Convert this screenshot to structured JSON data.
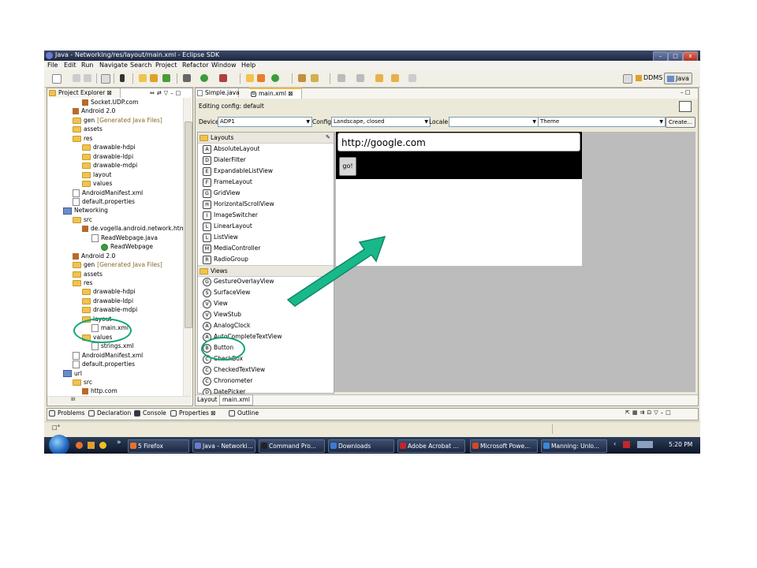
{
  "window": {
    "title": "Java - Networking/res/layout/main.xml - Eclipse SDK",
    "btn_min": "–",
    "btn_max": "□",
    "btn_close": "x"
  },
  "menu": [
    "File",
    "Edit",
    "Run",
    "Navigate",
    "Search",
    "Project",
    "Refactor",
    "Window",
    "Help"
  ],
  "perspectives": {
    "ddms": "DDMS",
    "java": "Java"
  },
  "project_explorer": {
    "title": "Project Explorer",
    "items": [
      {
        "label": "Socket.UDP.com",
        "icon": "package",
        "indent": 3
      },
      {
        "label": "Android 2.0",
        "icon": "library",
        "indent": 2
      },
      {
        "label": "gen",
        "suffix": "[Generated Java Files]",
        "icon": "folder",
        "indent": 2
      },
      {
        "label": "assets",
        "icon": "folder",
        "indent": 2
      },
      {
        "label": "res",
        "icon": "folder",
        "indent": 2
      },
      {
        "label": "drawable-hdpi",
        "icon": "folder",
        "indent": 3
      },
      {
        "label": "drawable-ldpi",
        "icon": "folder",
        "indent": 3
      },
      {
        "label": "drawable-mdpi",
        "icon": "folder",
        "indent": 3
      },
      {
        "label": "layout",
        "icon": "folder",
        "indent": 3
      },
      {
        "label": "values",
        "icon": "folder",
        "indent": 3
      },
      {
        "label": "AndroidManifest.xml",
        "icon": "file",
        "indent": 2
      },
      {
        "label": "default.properties",
        "icon": "file",
        "indent": 2
      },
      {
        "label": "Networking",
        "icon": "project",
        "indent": 1
      },
      {
        "label": "src",
        "icon": "folder",
        "indent": 2
      },
      {
        "label": "de.vogella.android.network.html",
        "icon": "package",
        "indent": 3
      },
      {
        "label": "ReadWebpage.java",
        "icon": "file",
        "indent": 4
      },
      {
        "label": "ReadWebpage",
        "icon": "class",
        "indent": 5
      },
      {
        "label": "Android 2.0",
        "icon": "library",
        "indent": 2
      },
      {
        "label": "gen",
        "suffix": "[Generated Java Files]",
        "icon": "folder",
        "indent": 2
      },
      {
        "label": "assets",
        "icon": "folder",
        "indent": 2
      },
      {
        "label": "res",
        "icon": "folder",
        "indent": 2
      },
      {
        "label": "drawable-hdpi",
        "icon": "folder",
        "indent": 3
      },
      {
        "label": "drawable-ldpi",
        "icon": "folder",
        "indent": 3
      },
      {
        "label": "drawable-mdpi",
        "icon": "folder",
        "indent": 3
      },
      {
        "label": "layout",
        "icon": "folder",
        "indent": 3
      },
      {
        "label": "main.xml",
        "icon": "file",
        "indent": 4
      },
      {
        "label": "values",
        "icon": "folder",
        "indent": 3
      },
      {
        "label": "strings.xml",
        "icon": "file",
        "indent": 4
      },
      {
        "label": "AndroidManifest.xml",
        "icon": "file",
        "indent": 2
      },
      {
        "label": "default.properties",
        "icon": "file",
        "indent": 2
      },
      {
        "label": "url",
        "icon": "project",
        "indent": 1
      },
      {
        "label": "src",
        "icon": "folder",
        "indent": 2
      },
      {
        "label": "http.com",
        "icon": "package",
        "indent": 3
      }
    ],
    "hscroll_label": "III"
  },
  "editor": {
    "tabs": [
      {
        "label": "Simple.java"
      },
      {
        "label": "main.xml"
      }
    ],
    "editing_config": "Editing config: default",
    "devices_label": "Devices",
    "device_value": "ADP1",
    "config_label": "Config",
    "config_value": "Landscape, closed",
    "locale_label": "Locale",
    "locale_value": "",
    "theme_value": "Theme",
    "create_button": "Create...",
    "bottom_tabs": [
      "Layout",
      "main.xml"
    ]
  },
  "palette": {
    "layouts_header": "Layouts",
    "layouts": [
      "AbsoluteLayout",
      "DialerFilter",
      "ExpandableListView",
      "FrameLayout",
      "GridView",
      "HorizontalScrollView",
      "ImageSwitcher",
      "LinearLayout",
      "ListView",
      "MediaController",
      "RadioGroup"
    ],
    "layout_icons": [
      "A",
      "D",
      "E",
      "F",
      "G",
      "H",
      "I",
      "L",
      "L",
      "M",
      "R"
    ],
    "views_header": "Views",
    "views": [
      "GestureOverlayView",
      "SurfaceView",
      "View",
      "ViewStub",
      "AnalogClock",
      "AutoCompleteTextView",
      "Button",
      "CheckBox",
      "CheckedTextView",
      "Chronometer",
      "DatePicker"
    ],
    "view_icons": [
      "G",
      "S",
      "V",
      "V",
      "A",
      "A",
      "B",
      "C",
      "C",
      "C",
      "D"
    ]
  },
  "preview": {
    "url_text": "http://google.com",
    "go_button": "go!"
  },
  "bottom_panel": {
    "tabs": [
      "Problems",
      "Declaration",
      "Console",
      "Properties",
      "Outline"
    ]
  },
  "taskbar": {
    "quicklaunch_more": "»",
    "items": [
      {
        "label": "5 Firefox",
        "color": "#e8702a"
      },
      {
        "label": "Java - Networki...",
        "color": "#6a7bd1"
      },
      {
        "label": "Command Pro...",
        "color": "#222222"
      },
      {
        "label": "Downloads",
        "color": "#3b7bd4"
      },
      {
        "label": "Adobe Acrobat ...",
        "color": "#c0262b"
      },
      {
        "label": "Microsoft Powe...",
        "color": "#d2491f"
      },
      {
        "label": "Manning: Unlo...",
        "color": "#3a88d9"
      }
    ],
    "clock": "5:20 PM"
  },
  "colors": {
    "highlight": "#11a47a",
    "arrow": "#19b88a"
  }
}
